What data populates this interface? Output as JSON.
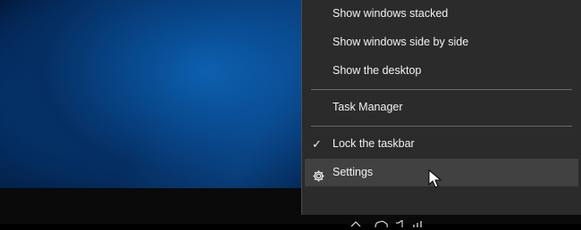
{
  "context_menu": {
    "items": [
      {
        "label": "Show windows stacked"
      },
      {
        "label": "Show windows side by side"
      },
      {
        "label": "Show the desktop"
      },
      {
        "label": "Task Manager"
      },
      {
        "label": "Lock the taskbar",
        "checked": true
      },
      {
        "label": "Settings",
        "icon": "gear-icon",
        "hovered": true
      }
    ],
    "check_glyph": "✓"
  },
  "tray": {
    "icons": [
      "chevron-up-icon",
      "cloud-icon",
      "volume-icon",
      "network-icon"
    ]
  },
  "colors": {
    "menu_bg": "#2b2b2b",
    "menu_hover": "#414141",
    "menu_text": "#f2f2f2",
    "separator": "#6a6a6a",
    "taskbar": "#0a0a0a"
  }
}
